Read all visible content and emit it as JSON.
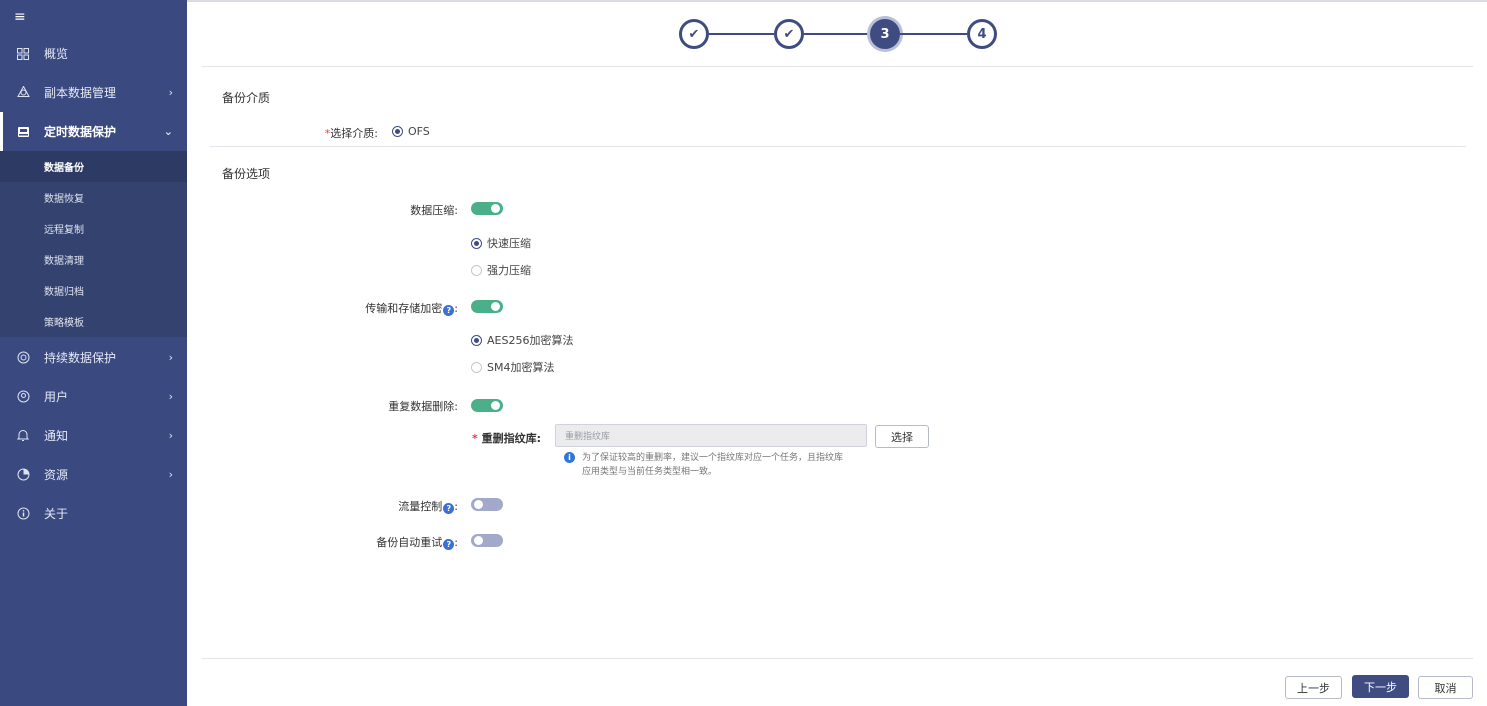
{
  "sidebar": {
    "items": [
      {
        "label": "概览",
        "icon": "grid-icon"
      },
      {
        "label": "副本数据管理",
        "icon": "copy-data-icon"
      },
      {
        "label": "定时数据保护",
        "icon": "timed-protect-icon"
      },
      {
        "label": "持续数据保护",
        "icon": "continuous-protect-icon"
      },
      {
        "label": "用户",
        "icon": "user-icon"
      },
      {
        "label": "通知",
        "icon": "bell-icon"
      },
      {
        "label": "资源",
        "icon": "pie-icon"
      },
      {
        "label": "关于",
        "icon": "info-icon"
      }
    ],
    "subitems": [
      "数据备份",
      "数据恢复",
      "远程复制",
      "数据清理",
      "数据归档",
      "策略模板"
    ]
  },
  "stepper": {
    "steps": [
      "✔",
      "✔",
      "3",
      "4"
    ],
    "current": 3
  },
  "media": {
    "section_title": "备份介质",
    "label": "选择介质:",
    "option": "OFS"
  },
  "options": {
    "section_title": "备份选项",
    "compression": {
      "label": "数据压缩:",
      "enabled": true,
      "choices": [
        "快速压缩",
        "强力压缩"
      ]
    },
    "encryption": {
      "label": "传输和存储加密",
      "colon": ":",
      "enabled": true,
      "choices": [
        "AES256加密算法",
        "SM4加密算法"
      ]
    },
    "dedup": {
      "label": "重复数据删除:",
      "enabled": true,
      "library_label": "重删指纹库:",
      "library_placeholder": "重删指纹库",
      "select_button": "选择",
      "hint_line1": "为了保证较高的重删率，建议一个指纹库对应一个任务，且指纹库",
      "hint_line2": "应用类型与当前任务类型相一致。"
    },
    "flow_control": {
      "label": "流量控制",
      "colon": ":",
      "enabled": false
    },
    "auto_retry": {
      "label": "备份自动重试",
      "colon": ":",
      "enabled": false
    }
  },
  "footer": {
    "prev": "上一步",
    "next": "下一步",
    "cancel": "取消"
  },
  "colors": {
    "sidebar": "#3a4a80",
    "accent": "#3f4c82",
    "toggle_on": "#4bb08a",
    "toggle_off": "#a3aac9"
  }
}
